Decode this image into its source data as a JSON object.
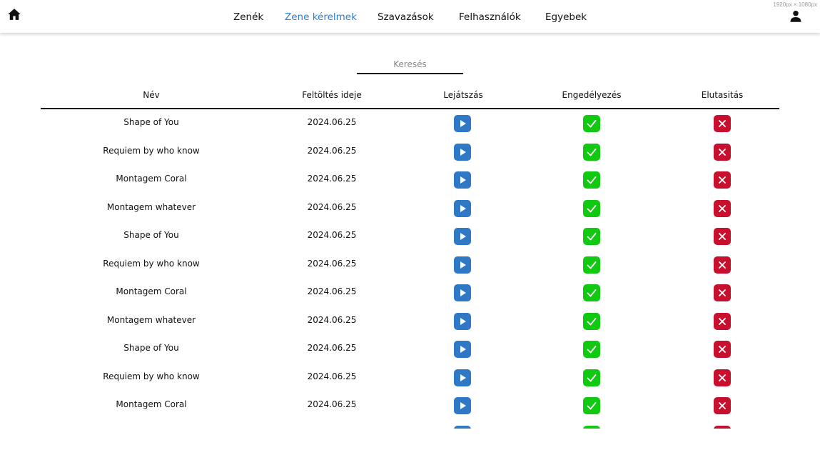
{
  "header": {
    "nav": [
      "Zenék",
      "Zene kérelmek",
      "Szavazások",
      "Felhasználók",
      "Egyebek"
    ],
    "active_index": 1,
    "dimensions": "1920px × 1080px"
  },
  "search": {
    "placeholder": "Keresés"
  },
  "table": {
    "columns": [
      "Név",
      "Feltöltés ideje",
      "Lejátszás",
      "Engedélyezés",
      "Elutasitás"
    ],
    "rows": [
      {
        "name": "Shape of You",
        "date": "2024.06.25"
      },
      {
        "name": "Requiem by who know",
        "date": "2024.06.25"
      },
      {
        "name": "Montagem Coral",
        "date": "2024.06.25"
      },
      {
        "name": "Montagem whatever",
        "date": "2024.06.25"
      },
      {
        "name": "Shape of You",
        "date": "2024.06.25"
      },
      {
        "name": "Requiem by who know",
        "date": "2024.06.25"
      },
      {
        "name": "Montagem Coral",
        "date": "2024.06.25"
      },
      {
        "name": "Montagem whatever",
        "date": "2024.06.25"
      },
      {
        "name": "Shape of You",
        "date": "2024.06.25"
      },
      {
        "name": "Requiem by who know",
        "date": "2024.06.25"
      },
      {
        "name": "Montagem Coral",
        "date": "2024.06.25"
      },
      {
        "name": "",
        "date": ""
      }
    ]
  },
  "icons": {
    "home": "home-icon",
    "user": "user-icon",
    "play": "play-icon",
    "approve": "check-icon",
    "reject": "x-icon"
  },
  "colors": {
    "active_nav": "#2b7fd0",
    "play": "#2f78c5",
    "approve": "#11c911",
    "reject": "#c8102e"
  }
}
